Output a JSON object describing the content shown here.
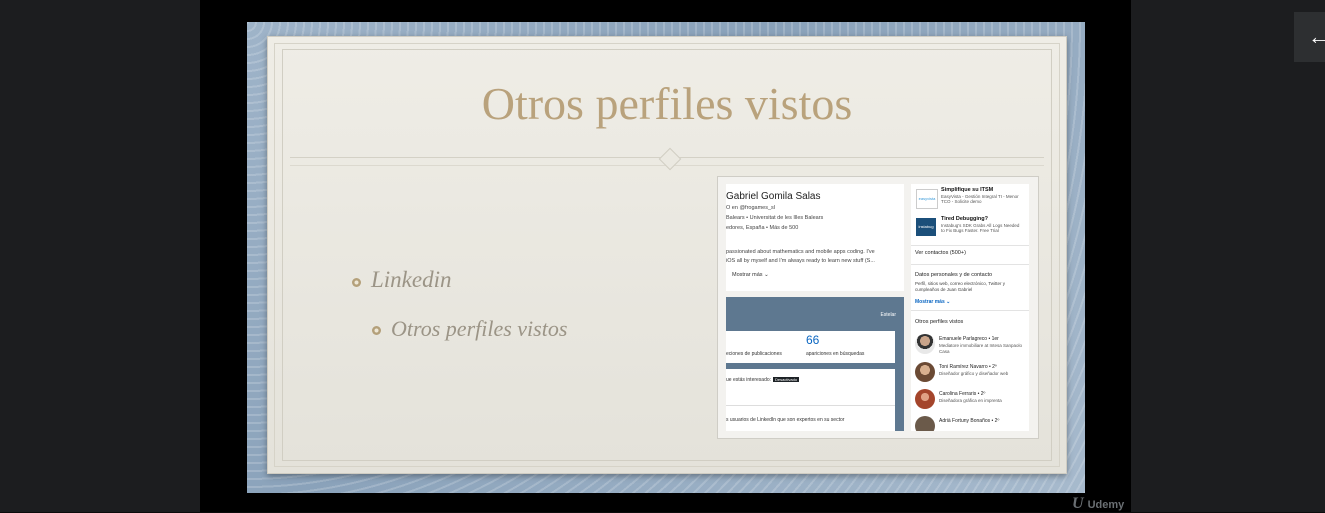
{
  "slide": {
    "title": "Otros perfiles vistos",
    "bullet_1": "Linkedin",
    "bullet_2": "Otros perfiles vistos"
  },
  "profile_card": {
    "name": "Gabriel Gomila Salas",
    "headline": "O en @frogames_sl",
    "education": "Balears • Universitat de les Illes Balears",
    "location": "edores, España • Más de 500",
    "about_1": "passionated about mathematics and mobile apps coding. I've",
    "about_2": "iOS all by myself and I'm always ready to learn new stuff (S...",
    "show_more": "Mostrar más"
  },
  "dashboard": {
    "edit_label": "Estelar",
    "count": "66",
    "label_left": "eciones de publicaciones",
    "label_right": "apariciones en búsquedas",
    "interest_text": "ue estás interesado:",
    "interest_badge": "Desactivado",
    "experts_text": "s usuarios de LinkedIn que son expertos en su sector"
  },
  "sidebar": {
    "ad1_logo": "easyvista",
    "ad1_title": "Simplifique su ITSM",
    "ad1_desc": "EasyVista - Gestión Integral TI - Menor TCO - Solicite demo",
    "ad2_logo": "instabug",
    "ad2_title": "Tired Debugging?",
    "ad2_desc": "Instabug's SDK Grabs All Logs Needed to Fix Bugs Faster. Free Trial",
    "contacts": "Ver contactos (500+)",
    "personal_title": "Datos personales y de contacto",
    "personal_desc": "Perfil, sitios web, correo electrónico, Twitter y cumpleaños de Juan Gabriel",
    "show_more": "Mostrar más",
    "others_title": "Otros perfiles vistos",
    "people": [
      {
        "name": "Emanuele Parlagreco • 1er",
        "role": "Mediatore immobiliare at Intesa Sanpaolo Casa"
      },
      {
        "name": "Toni Ramírez Navarro • 2º",
        "role": "Diseñador gráfico y diseñador web"
      },
      {
        "name": "Carolina Ferraris • 2º",
        "role": "Diseñadora gráfica en imprenta"
      },
      {
        "name": "Adrià Fortuny Bonaños • 2º",
        "role": ""
      }
    ]
  },
  "player": {
    "back_icon": "←",
    "brand": "Udemy",
    "brand_mark": "U"
  }
}
